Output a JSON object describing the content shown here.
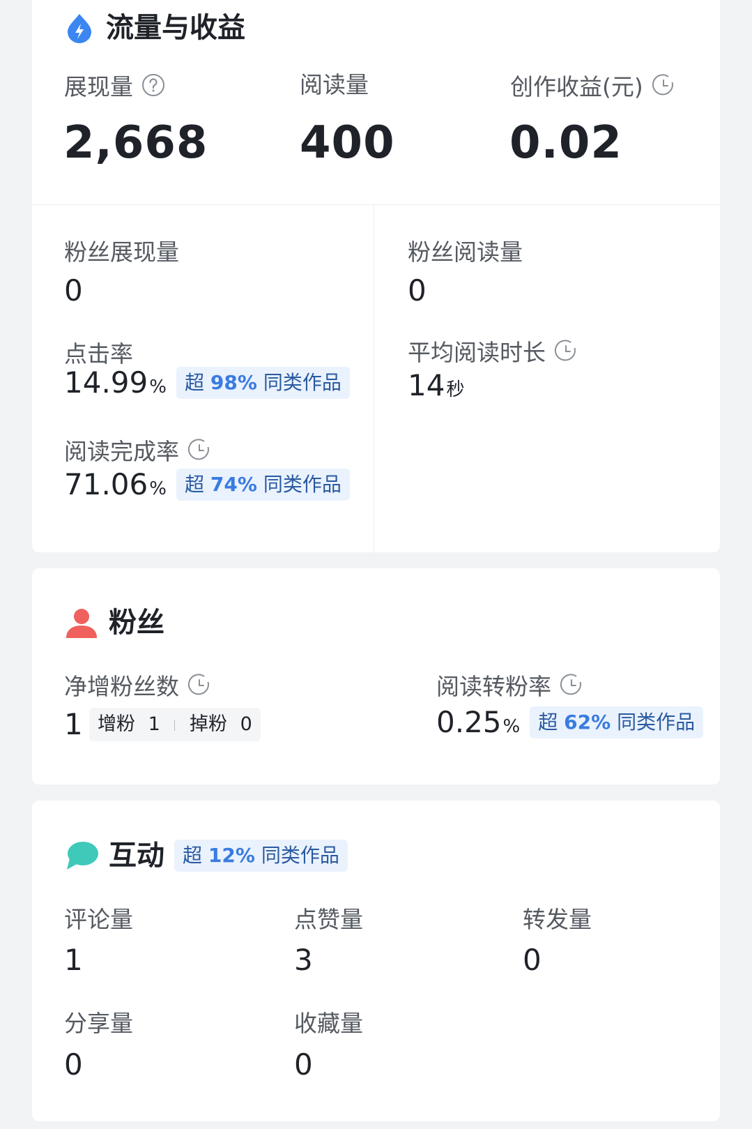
{
  "traffic": {
    "title": "流量与收益",
    "impressions": {
      "label": "展现量",
      "value": "2,668"
    },
    "reads": {
      "label": "阅读量",
      "value": "400"
    },
    "earnings": {
      "label": "创作收益(元)",
      "value": "0.02"
    },
    "fan_impressions": {
      "label": "粉丝展现量",
      "value": "0"
    },
    "fan_reads": {
      "label": "粉丝阅读量",
      "value": "0"
    },
    "ctr": {
      "label": "点击率",
      "value": "14.99",
      "unit": "%",
      "badge": {
        "prefix": "超",
        "pct": "98%",
        "suffix": "同类作品"
      }
    },
    "avg_read_time": {
      "label": "平均阅读时长",
      "value": "14",
      "unit": "秒"
    },
    "completion_rate": {
      "label": "阅读完成率",
      "value": "71.06",
      "unit": "%",
      "badge": {
        "prefix": "超",
        "pct": "74%",
        "suffix": "同类作品"
      }
    }
  },
  "fans": {
    "title": "粉丝",
    "net_gain": {
      "label": "净增粉丝数",
      "value": "1",
      "gain_label": "增粉",
      "gain_value": "1",
      "loss_label": "掉粉",
      "loss_value": "0"
    },
    "conversion": {
      "label": "阅读转粉率",
      "value": "0.25",
      "unit": "%",
      "badge": {
        "prefix": "超",
        "pct": "62%",
        "suffix": "同类作品"
      }
    }
  },
  "interaction": {
    "title": "互动",
    "badge": {
      "prefix": "超",
      "pct": "12%",
      "suffix": "同类作品"
    },
    "comments": {
      "label": "评论量",
      "value": "1"
    },
    "likes": {
      "label": "点赞量",
      "value": "3"
    },
    "reposts": {
      "label": "转发量",
      "value": "0"
    },
    "shares": {
      "label": "分享量",
      "value": "0"
    },
    "favorites": {
      "label": "收藏量",
      "value": "0"
    }
  },
  "colors": {
    "traffic_icon": "#3b86f0",
    "fans_icon": "#f0605c",
    "interaction_icon": "#3fc9b9",
    "badge_bg": "#eaf2fd",
    "badge_text": "#2d6fd1"
  },
  "icons": {
    "traffic": "lightning-drop-icon",
    "fans": "person-icon",
    "interaction": "chat-bubble-icon",
    "help": "question-circle-icon",
    "clock": "clock-icon"
  }
}
